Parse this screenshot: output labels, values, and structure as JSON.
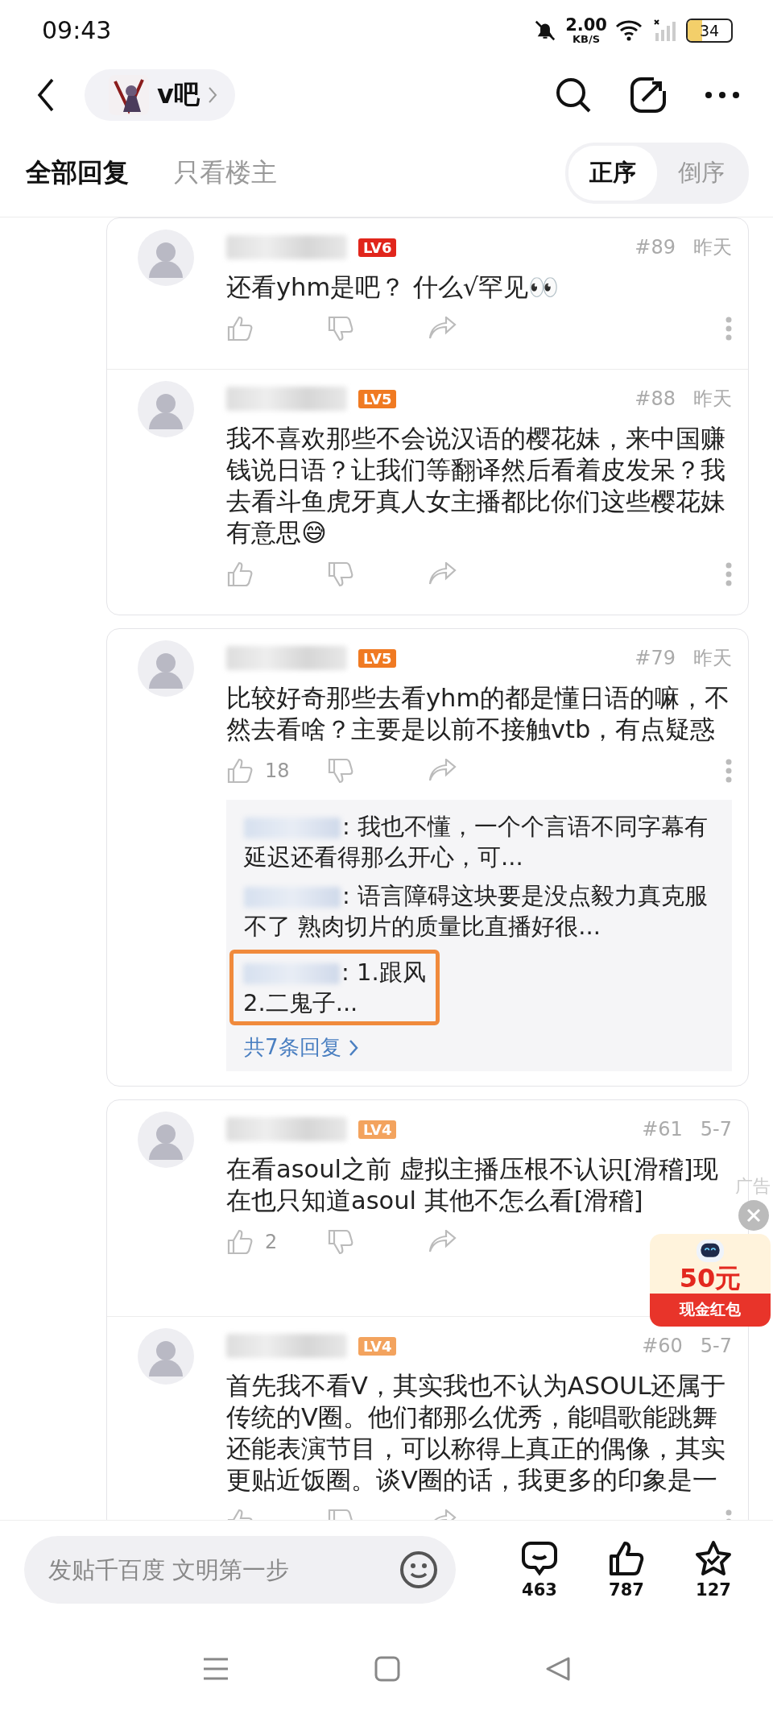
{
  "status_bar": {
    "time": "09:43",
    "speed": "2.00",
    "speed_unit": "KB/S",
    "battery": "34"
  },
  "header": {
    "forum": "v吧"
  },
  "tabs": [
    {
      "label": "全部回复",
      "selected": true
    },
    {
      "label": "只看楼主",
      "selected": false
    }
  ],
  "sort": [
    {
      "label": "正序",
      "selected": true
    },
    {
      "label": "倒序",
      "selected": false
    }
  ],
  "cards": [
    {
      "posts": [
        {
          "level": "LV6",
          "color": "#e1261c",
          "floor": "#89",
          "time": "昨天",
          "text": "还看yhm是吧？ 什么√罕见👀"
        },
        {
          "level": "LV5",
          "color": "#f07a22",
          "floor": "#88",
          "time": "昨天",
          "text": "我不喜欢那些不会说汉语的樱花妹，来中国赚钱说日语？让我们等翻译然后看着皮发呆？我去看斗鱼虎牙真人女主播都比你们这些樱花妹有意思😅"
        }
      ]
    },
    {
      "posts": [
        {
          "level": "LV5",
          "color": "#f07a22",
          "floor": "#79",
          "time": "昨天",
          "text": "比较好奇那些去看yhm的都是懂日语的嘛，不然去看啥？主要是以前不接触vtb，有点疑惑",
          "likes": "18",
          "replies": [
            {
              "text": ": 我也不懂，一个个言语不同字幕有延迟还看得那么开心，可...",
              "highlighted": false
            },
            {
              "text": ": 语言障碍这块要是没点毅力真克服不了  熟肉切片的质量比直播好很...",
              "highlighted": false
            },
            {
              "text": ": 1.跟风\n2.二鬼子...",
              "highlighted": true
            }
          ],
          "more_replies": "共7条回复"
        }
      ]
    },
    {
      "posts": [
        {
          "level": "LV4",
          "color": "#f3a35e",
          "floor": "#61",
          "time": "5-7",
          "text": "在看asoul之前 虚拟主播压根不认识[滑稽]现在也只知道asoul 其他不怎么看[滑稽]",
          "likes": "2"
        },
        {
          "level": "LV4",
          "color": "#f3a35e",
          "floor": "#60",
          "time": "5-7",
          "text": "首先我不看V，其实我也不认为ASOUL还属于传统的V圈。他们都那么优秀，能唱歌能跳舞还能表演节目，可以称得上真正的偶像，其实更贴近饭圈。谈V圈的话，我更多的印象是一"
        }
      ]
    }
  ],
  "ad": {
    "label": "广告",
    "amount": "50元",
    "caption": "现金红包"
  },
  "composer": {
    "placeholder": "发贴千百度 文明第一步"
  },
  "stats": [
    {
      "kind": "comments",
      "count": "463"
    },
    {
      "kind": "likes",
      "count": "787"
    },
    {
      "kind": "favorites",
      "count": "127"
    }
  ]
}
